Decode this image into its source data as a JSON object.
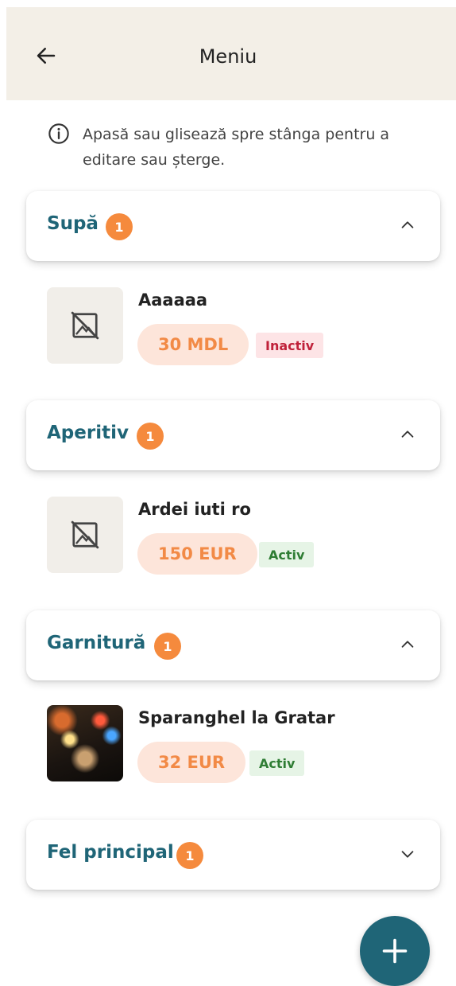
{
  "header": {
    "title": "Meniu",
    "back_icon": "arrow-left-icon"
  },
  "hint": {
    "icon": "info-icon",
    "text": "Apasă sau glisează spre stânga pentru a editare sau șterge."
  },
  "categories": [
    {
      "name": "Supă",
      "count": "1",
      "expanded": true,
      "items": [
        {
          "name": "Aaaaaa",
          "price": "30 MDL",
          "status": "Inactiv",
          "image": "no-image-icon"
        }
      ]
    },
    {
      "name": "Aperitiv",
      "count": "1",
      "expanded": true,
      "items": [
        {
          "name": "Ardei iuti ro",
          "price": "150 EUR",
          "status": "Activ",
          "image": "no-image-icon"
        }
      ]
    },
    {
      "name": "Garnitură",
      "count": "1",
      "expanded": true,
      "items": [
        {
          "name": "Sparanghel la Gratar",
          "price": "32 EUR",
          "status": "Activ",
          "image": "photo"
        }
      ]
    },
    {
      "name": "Fel principal",
      "count": "1",
      "expanded": false,
      "items": []
    }
  ],
  "fab": {
    "icon": "plus-icon"
  },
  "colors": {
    "header_bg": "#f3efe7",
    "accent_teal": "#1f6577",
    "badge_orange": "#f58a3d",
    "price_bg": "#fde5da",
    "price_text": "#f28a46",
    "inactive_bg": "#fde4e6",
    "inactive_text": "#c0213a",
    "active_bg": "#e6f4e6",
    "active_text": "#2f7d34"
  }
}
